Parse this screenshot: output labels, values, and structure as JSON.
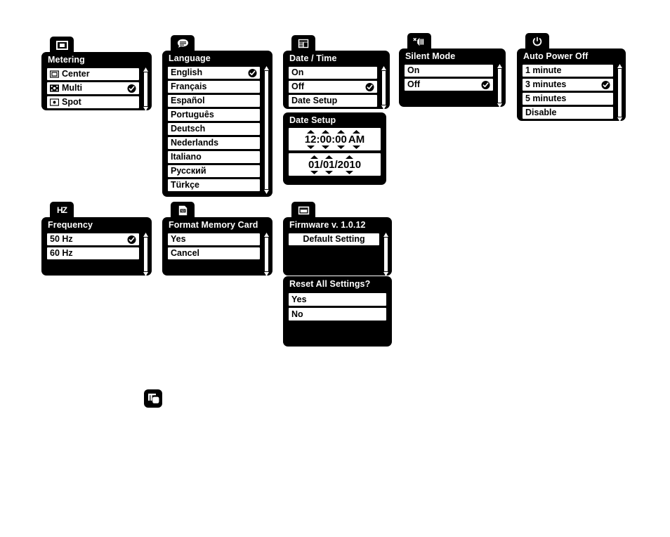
{
  "colors": {
    "ink": "#000000",
    "paper": "#ffffff"
  },
  "panels": {
    "metering": {
      "tab_icon": "center-metering-icon",
      "title": "Metering",
      "items": [
        {
          "label": "Center",
          "icon": "metering-center-icon",
          "selected": false
        },
        {
          "label": "Multi",
          "icon": "metering-multi-icon",
          "selected": true
        },
        {
          "label": "Spot",
          "icon": "metering-spot-icon",
          "selected": false
        }
      ]
    },
    "language": {
      "tab_icon": "speech-bubble-icon",
      "title": "Language",
      "items": [
        {
          "label": "English",
          "selected": true
        },
        {
          "label": "Français",
          "selected": false
        },
        {
          "label": "Español",
          "selected": false
        },
        {
          "label": "Português",
          "selected": false
        },
        {
          "label": "Deutsch",
          "selected": false
        },
        {
          "label": "Nederlands",
          "selected": false
        },
        {
          "label": "Italiano",
          "selected": false
        },
        {
          "label": "Русский",
          "selected": false
        },
        {
          "label": "Türkçe",
          "selected": false
        }
      ]
    },
    "datetime": {
      "tab_icon": "calendar-icon",
      "title": "Date / Time",
      "items": [
        {
          "label": "On",
          "selected": false
        },
        {
          "label": "Off",
          "selected": true
        },
        {
          "label": "Date Setup",
          "selected": false
        }
      ]
    },
    "date_setup": {
      "title": "Date Setup",
      "time": {
        "hour": "12",
        "minute": "00",
        "second": "00",
        "meridiem": "AM",
        "sep": ":"
      },
      "date": {
        "month": "01",
        "day": "01",
        "year": "2010",
        "sep": "/"
      }
    },
    "silent_mode": {
      "tab_icon": "mute-speaker-icon",
      "title": "Silent Mode",
      "items": [
        {
          "label": "On",
          "selected": false
        },
        {
          "label": "Off",
          "selected": true
        }
      ]
    },
    "auto_power_off": {
      "tab_icon": "power-icon",
      "title": "Auto Power Off",
      "items": [
        {
          "label": "1 minute",
          "selected": false
        },
        {
          "label": "3 minutes",
          "selected": true
        },
        {
          "label": "5 minutes",
          "selected": false
        },
        {
          "label": "Disable",
          "selected": false
        }
      ]
    },
    "frequency": {
      "tab_icon": "hz-icon",
      "tab_text": "HZ",
      "title": "Frequency",
      "items": [
        {
          "label": "50 Hz",
          "selected": true
        },
        {
          "label": "60 Hz",
          "selected": false
        }
      ]
    },
    "format_memory_card": {
      "tab_icon": "sd-card-icon",
      "tab_text": "SD",
      "title": "Format Memory Card",
      "items": [
        {
          "label": "Yes",
          "selected": false
        },
        {
          "label": "Cancel",
          "selected": false
        }
      ]
    },
    "firmware": {
      "tab_icon": "monitor-icon",
      "title": "Firmware v. 1.0.12",
      "items": [
        {
          "label": "Default Setting",
          "selected": false
        }
      ]
    },
    "reset_all": {
      "title": "Reset All Settings?",
      "items": [
        {
          "label": "Yes",
          "selected": false
        },
        {
          "label": "No",
          "selected": false
        }
      ]
    }
  },
  "loose_icon": {
    "name": "multi-frame-icon"
  }
}
